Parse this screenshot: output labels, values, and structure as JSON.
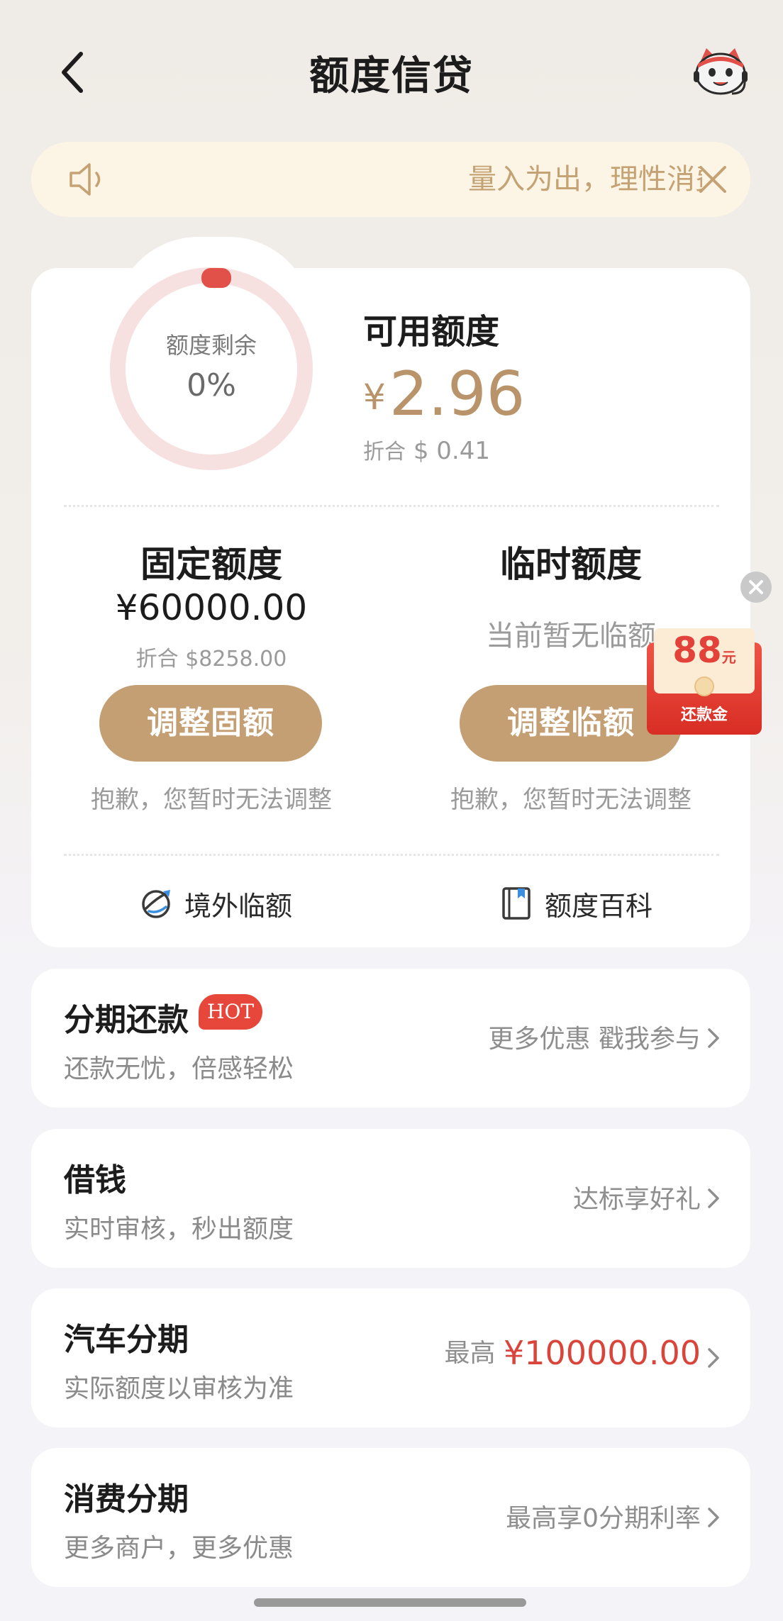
{
  "header": {
    "title": "额度信贷",
    "back_icon": "chevron-left-icon",
    "mascot_icon": "mascot-avatar-icon"
  },
  "notice": {
    "text": "量入为出，理性消费",
    "icon": "speaker-icon",
    "close_icon": "close-icon"
  },
  "quota": {
    "ring_label": "额度剩余",
    "ring_percent": "0%",
    "ring_percent_value": 0,
    "available_title": "可用额度",
    "available_currency": "¥",
    "available_amount": "2.96",
    "available_converted_prefix": "折合",
    "available_converted": "$ 0.41"
  },
  "fixed": {
    "title": "固定额度",
    "amount": "¥60000.00",
    "converted": "折合 $8258.00",
    "button": "调整固额",
    "note": "抱歉，您暂时无法调整"
  },
  "temporary": {
    "title": "临时额度",
    "status": "当前暂无临额",
    "button": "调整临额",
    "note": "抱歉，您暂时无法调整"
  },
  "links": [
    {
      "label": "境外临额",
      "icon": "globe-plane-icon"
    },
    {
      "label": "额度百科",
      "icon": "book-icon"
    }
  ],
  "float_packet": {
    "amount": "88",
    "unit": "元",
    "label": "还款金",
    "close_icon": "close-icon"
  },
  "services": [
    {
      "title": "分期还款",
      "badge": "HOT",
      "subtitle": "还款无忧，倍感轻松",
      "right_text": "更多优惠 戳我参与"
    },
    {
      "title": "借钱",
      "subtitle": "实时审核，秒出额度",
      "right_text": "达标享好礼"
    },
    {
      "title": "汽车分期",
      "subtitle": "实际额度以审核为准",
      "right_prefix": "最高",
      "right_amount": "¥100000.00"
    },
    {
      "title": "消费分期",
      "subtitle": "更多商户，更多优惠",
      "right_text": "最高享0分期利率"
    }
  ],
  "colors": {
    "accent_gold": "#c49f73",
    "amount_gold": "#b9946a",
    "hot_red": "#e6473a",
    "ring_track": "#f6e0e0",
    "ring_cap": "#e2504a"
  }
}
